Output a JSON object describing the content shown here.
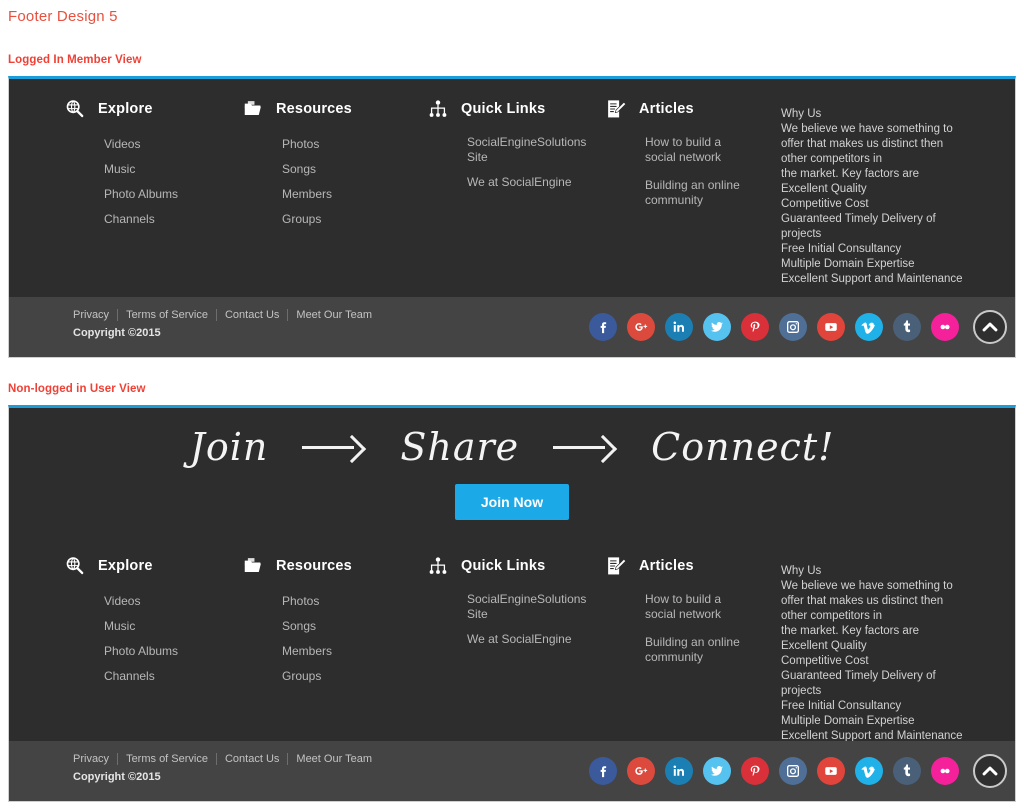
{
  "page": {
    "title": "Footer Design 5",
    "sections": [
      {
        "label": "Logged In Member View"
      },
      {
        "label": "Non-logged in User View"
      }
    ]
  },
  "colors": {
    "title": "#e8513f",
    "section_label": "#ef4136",
    "accent_top_border": "#1b9dd9",
    "panel_bg": "#2d2d2d",
    "bottombar_bg": "#444444",
    "join_button": "#1ba9e8"
  },
  "hero": {
    "words": [
      "Join",
      "Share",
      "Connect!"
    ],
    "arrow_icon": "arrow-right-icon",
    "join_button_label": "Join Now"
  },
  "columns": [
    {
      "icon": "globe-search-icon",
      "title": "Explore",
      "links": [
        "Videos",
        "Music",
        "Photo Albums",
        "Channels"
      ]
    },
    {
      "icon": "folder-icon",
      "title": "Resources",
      "links": [
        "Photos",
        "Songs",
        "Members",
        "Groups"
      ]
    },
    {
      "icon": "sitemap-icon",
      "title": "Quick Links",
      "links": [
        "SocialEngineSolutions Site",
        "We at SocialEngine"
      ]
    },
    {
      "icon": "document-edit-icon",
      "title": "Articles",
      "links": [
        "How to build a social network",
        "Building an online community"
      ]
    }
  ],
  "whyus": {
    "lines": [
      "Why Us",
      "We believe we have something to",
      "offer that makes us distinct then",
      "other competitors in",
      "the market. Key factors are",
      "Excellent Quality",
      "Competitive Cost",
      "Guaranteed Timely Delivery of",
      "projects",
      "Free Initial Consultancy",
      "Multiple Domain Expertise",
      "Excellent Support and Maintenance"
    ]
  },
  "bottombar": {
    "links": [
      "Privacy",
      "Terms of Service",
      "Contact Us",
      "Meet Our Team"
    ],
    "copyright": "Copyright ©2015",
    "scroll_top_icon": "chevron-up-icon",
    "socials": [
      {
        "name": "facebook",
        "glyph": "f",
        "color": "#3b5a9b"
      },
      {
        "name": "googleplus",
        "glyph": "g+",
        "color": "#dc4a3d"
      },
      {
        "name": "linkedin",
        "glyph": "in",
        "color": "#1b7fb4"
      },
      {
        "name": "twitter",
        "glyph": "t",
        "color": "#55c2ef"
      },
      {
        "name": "pinterest",
        "glyph": "p",
        "color": "#d9303a"
      },
      {
        "name": "instagram",
        "glyph": "ig",
        "color": "#4f6f96"
      },
      {
        "name": "youtube",
        "glyph": "yt",
        "color": "#e0443a"
      },
      {
        "name": "vimeo",
        "glyph": "v",
        "color": "#1fb1e8"
      },
      {
        "name": "tumblr",
        "glyph": "t",
        "color": "#4a6079"
      },
      {
        "name": "flickr",
        "glyph": "fl",
        "color": "#f5219b"
      }
    ]
  }
}
